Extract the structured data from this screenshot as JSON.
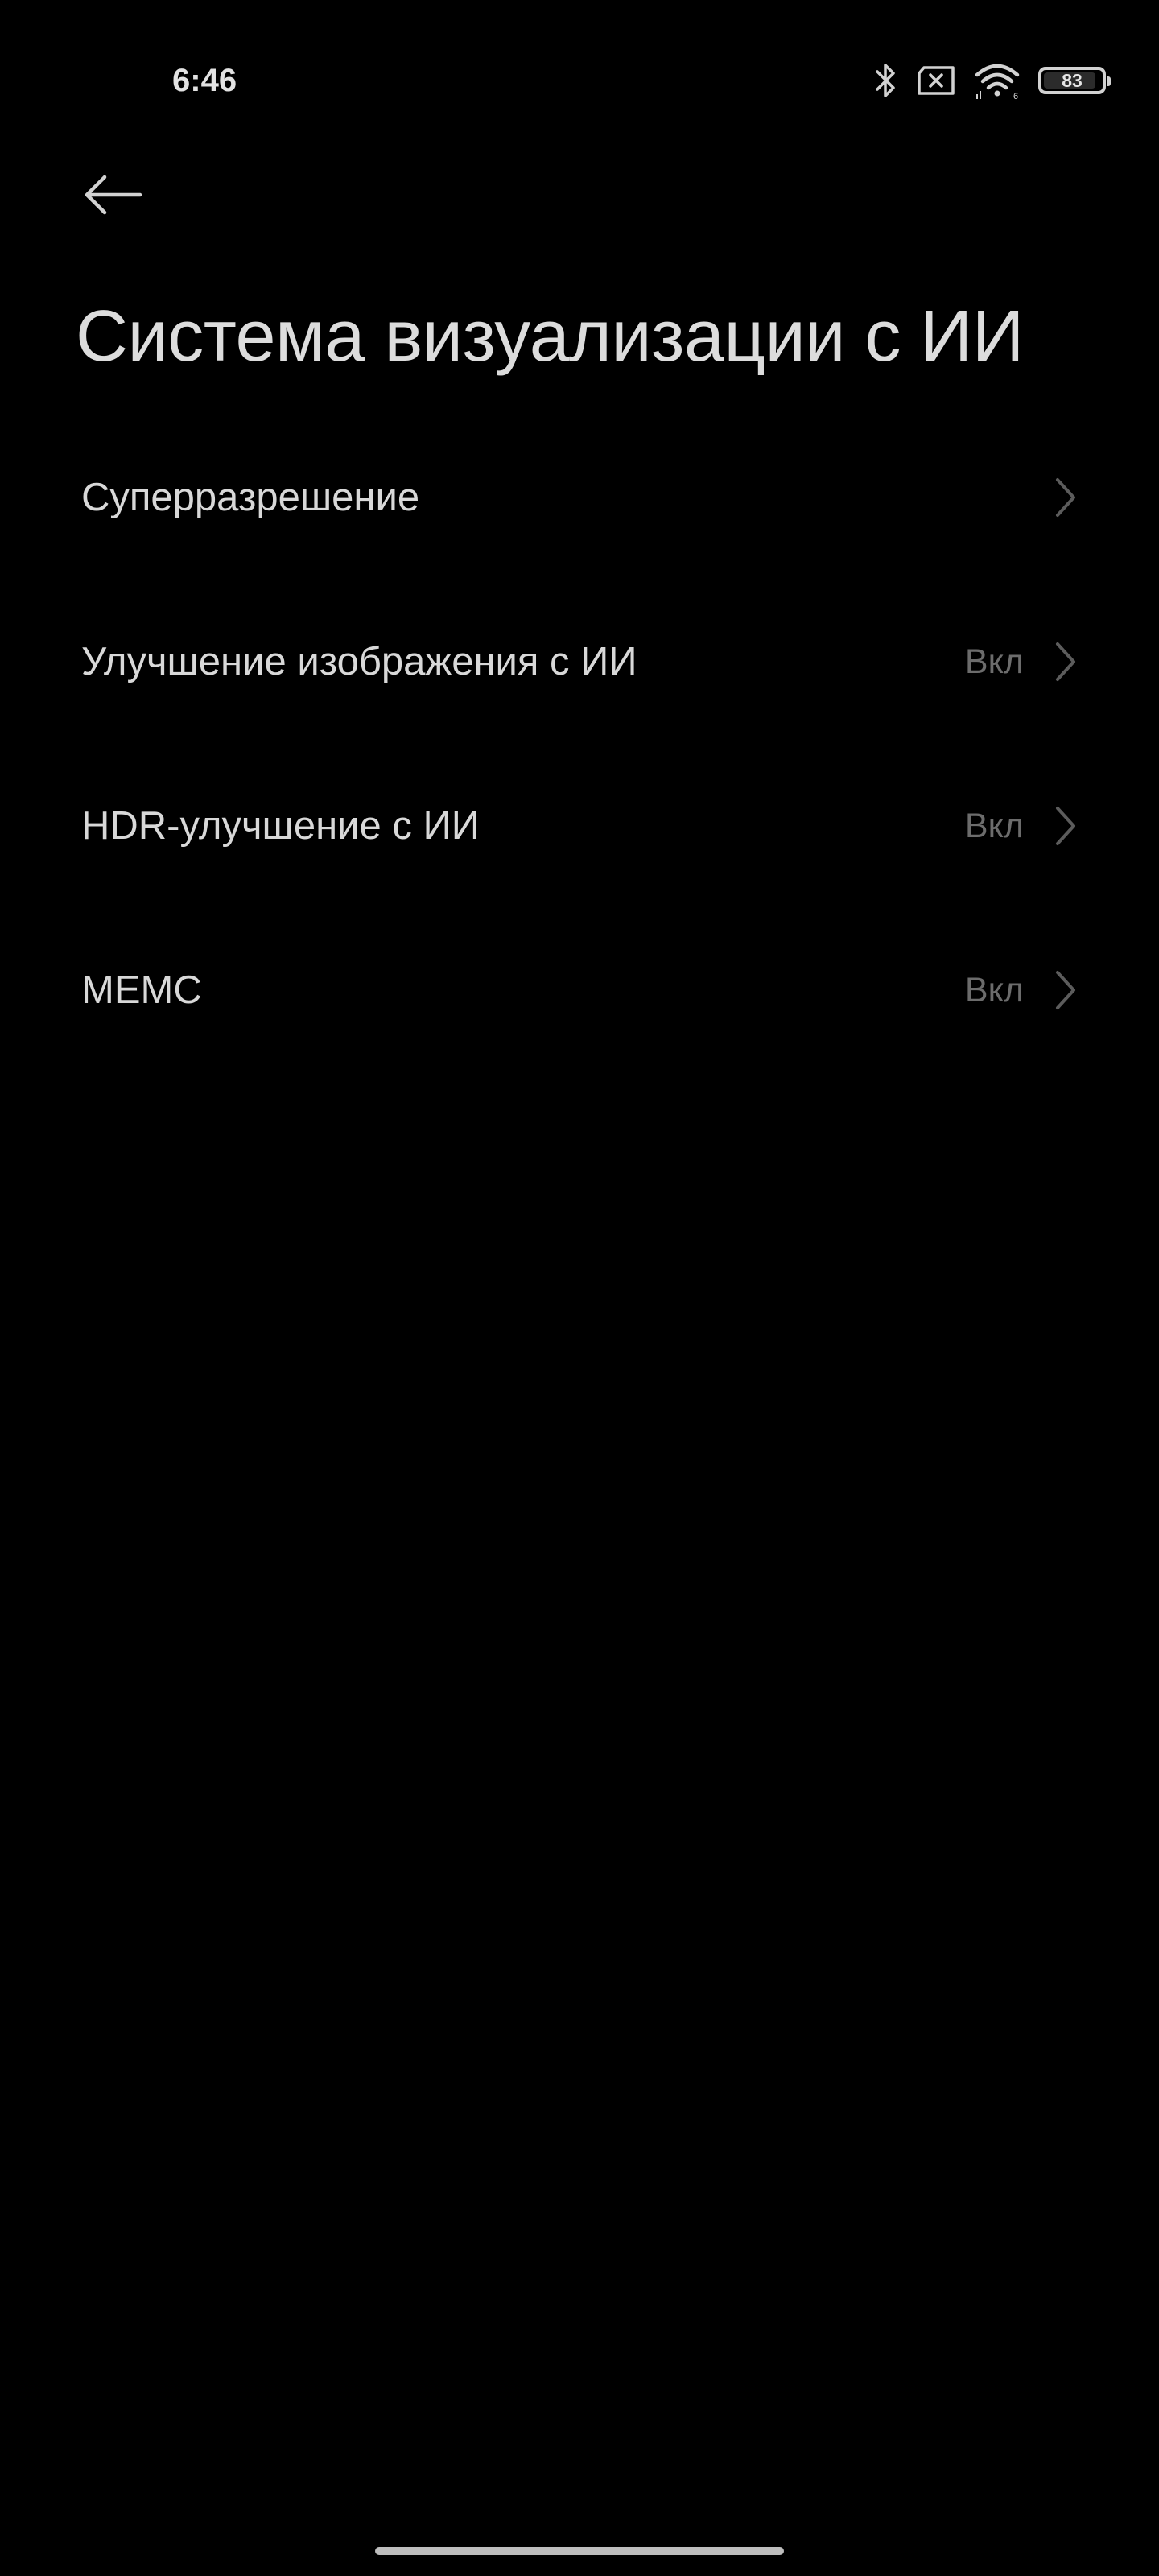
{
  "status_bar": {
    "time": "6:46",
    "battery_level": "83",
    "icons": [
      "bluetooth-icon",
      "no-sim-icon",
      "wifi-icon",
      "battery-icon"
    ]
  },
  "header": {
    "back_icon": "arrow-left-icon",
    "title": "Система визуализации с ИИ"
  },
  "settings": {
    "items": [
      {
        "label": "Суперразрешение",
        "value": ""
      },
      {
        "label": "Улучшение изображения с ИИ",
        "value": "Вкл"
      },
      {
        "label": "HDR-улучшение с ИИ",
        "value": "Вкл"
      },
      {
        "label": "MEMC",
        "value": "Вкл"
      }
    ]
  },
  "colors": {
    "background": "#000000",
    "text_primary": "#d8d8d8",
    "text_secondary": "#6c6c6c"
  }
}
